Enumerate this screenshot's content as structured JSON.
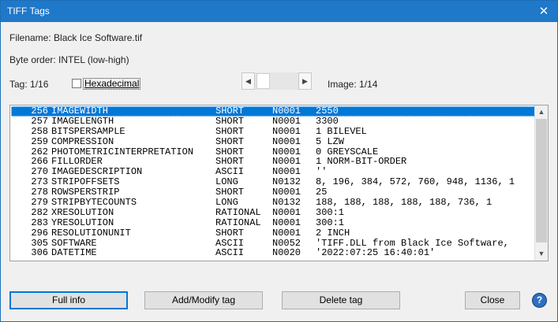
{
  "window": {
    "title": "TIFF Tags",
    "close_glyph": "✕"
  },
  "info": {
    "filename": "Filename: Black Ice Software.tif",
    "byte_order": "Byte order: INTEL (low-high)",
    "tag": "Tag: 1/16",
    "hexadecimal_label": "Hexadecimal",
    "hexadecimal_checked": false,
    "image": "Image: 1/14"
  },
  "scroll_icons": {
    "left": "◀",
    "right": "▶",
    "up": "▲",
    "down": "▼"
  },
  "tags": [
    {
      "num": "256",
      "name": "IMAGEWIDTH",
      "type": "SHORT",
      "count": "N0001",
      "value": "2550"
    },
    {
      "num": "257",
      "name": "IMAGELENGTH",
      "type": "SHORT",
      "count": "N0001",
      "value": "3300"
    },
    {
      "num": "258",
      "name": "BITSPERSAMPLE",
      "type": "SHORT",
      "count": "N0001",
      "value": "1      BILEVEL"
    },
    {
      "num": "259",
      "name": "COMPRESSION",
      "type": "SHORT",
      "count": "N0001",
      "value": "5      LZW"
    },
    {
      "num": "262",
      "name": "PHOTOMETRICINTERPRETATION",
      "type": "SHORT",
      "count": "N0001",
      "value": "0      GREYSCALE"
    },
    {
      "num": "266",
      "name": "FILLORDER",
      "type": "SHORT",
      "count": "N0001",
      "value": "1      NORM-BIT-ORDER"
    },
    {
      "num": "270",
      "name": "IMAGEDESCRIPTION",
      "type": "ASCII",
      "count": "N0001",
      "value": "''"
    },
    {
      "num": "273",
      "name": "STRIPOFFSETS",
      "type": "LONG",
      "count": "N0132",
      "value": "8, 196, 384, 572, 760, 948, 1136, 1"
    },
    {
      "num": "278",
      "name": "ROWSPERSTRIP",
      "type": "SHORT",
      "count": "N0001",
      "value": "25"
    },
    {
      "num": "279",
      "name": "STRIPBYTECOUNTS",
      "type": "LONG",
      "count": "N0132",
      "value": "188, 188, 188, 188, 188, 736, 1"
    },
    {
      "num": "282",
      "name": "XRESOLUTION",
      "type": "RATIONAL",
      "count": "N0001",
      "value": "300:1"
    },
    {
      "num": "283",
      "name": "YRESOLUTION",
      "type": "RATIONAL",
      "count": "N0001",
      "value": "300:1"
    },
    {
      "num": "296",
      "name": "RESOLUTIONUNIT",
      "type": "SHORT",
      "count": "N0001",
      "value": "2      INCH"
    },
    {
      "num": "305",
      "name": "SOFTWARE",
      "type": "ASCII",
      "count": "N0052",
      "value": "'TIFF.DLL from Black Ice Software,"
    },
    {
      "num": "306",
      "name": "DATETIME",
      "type": "ASCII",
      "count": "N0020",
      "value": "'2022:07:25 16:40:01'"
    }
  ],
  "selected_row": 0,
  "buttons": {
    "full_info": "Full info",
    "add_modify": "Add/Modify tag",
    "delete": "Delete tag",
    "close": "Close",
    "help": "?"
  }
}
